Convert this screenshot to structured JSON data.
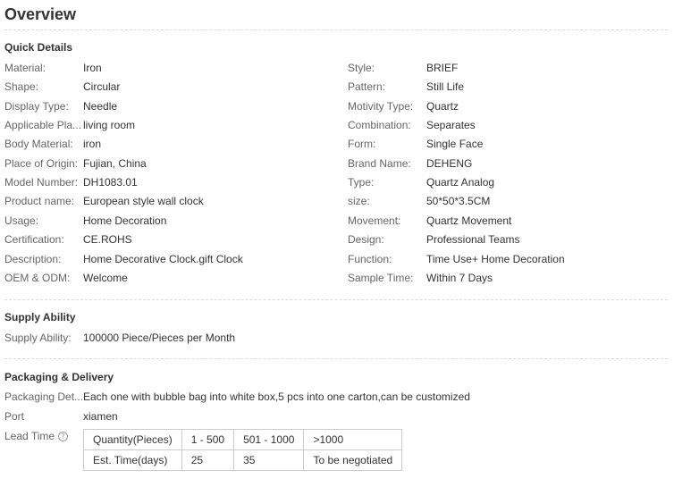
{
  "title": "Overview",
  "quick_details": {
    "heading": "Quick Details",
    "left": [
      {
        "label": "Material:",
        "value": "Iron"
      },
      {
        "label": "Shape:",
        "value": "Circular"
      },
      {
        "label": "Display Type:",
        "value": "Needle"
      },
      {
        "label": "Applicable Pla...",
        "value": "living room"
      },
      {
        "label": "Body Material:",
        "value": "iron"
      },
      {
        "label": "Place of Origin:",
        "value": "Fujian, China"
      },
      {
        "label": "Model Number:",
        "value": "DH1083.01"
      },
      {
        "label": "Product name:",
        "value": "European style wall clock"
      },
      {
        "label": "Usage:",
        "value": "Home Decoration"
      },
      {
        "label": "Certification:",
        "value": "CE.ROHS"
      },
      {
        "label": "Description:",
        "value": "Home Decorative Clock.gift Clock"
      },
      {
        "label": "OEM & ODM:",
        "value": "Welcome"
      }
    ],
    "right": [
      {
        "label": "Style:",
        "value": "BRIEF"
      },
      {
        "label": "Pattern:",
        "value": "Still Life"
      },
      {
        "label": "Motivity Type:",
        "value": "Quartz"
      },
      {
        "label": "Combination:",
        "value": "Separates"
      },
      {
        "label": "Form:",
        "value": "Single Face"
      },
      {
        "label": "Brand Name:",
        "value": "DEHENG"
      },
      {
        "label": "Type:",
        "value": "Quartz Analog"
      },
      {
        "label": "size:",
        "value": "50*50*3.5CM"
      },
      {
        "label": "Movement:",
        "value": "Quartz Movement"
      },
      {
        "label": "Design:",
        "value": "Professional Teams"
      },
      {
        "label": "Function:",
        "value": "Time Use+ Home Decoration"
      },
      {
        "label": "Sample Time:",
        "value": "Within 7 Days"
      }
    ]
  },
  "supply_ability": {
    "heading": "Supply Ability",
    "label": "Supply Ability:",
    "value": "100000 Piece/Pieces per Month"
  },
  "packaging": {
    "heading": "Packaging & Delivery",
    "details_label": "Packaging Det...",
    "details_value": "Each one with bubble bag into white box,5 pcs into one carton,can be customized",
    "port_label": "Port",
    "port_value": "xiamen",
    "lead_time_label": "Lead Time",
    "help_icon": "question-circle-icon",
    "lead_table": {
      "rows": [
        [
          "Quantity(Pieces)",
          "1 - 500",
          "501 - 1000",
          ">1000"
        ],
        [
          "Est. Time(days)",
          "25",
          "35",
          "To be negotiated"
        ]
      ]
    }
  }
}
